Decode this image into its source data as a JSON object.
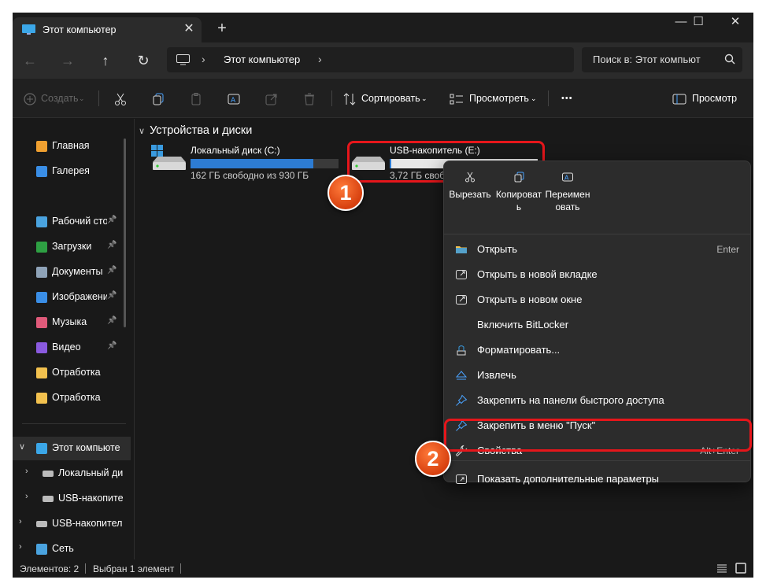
{
  "window": {
    "tab_title": "Этот компьютер",
    "tab_close": "✕",
    "new_tab": "+",
    "minimize": "—",
    "maximize": "☐",
    "close": "✕"
  },
  "nav": {
    "back": "←",
    "forward": "→",
    "up": "↑",
    "refresh": "↻",
    "breadcrumb": "Этот компьютер",
    "search_placeholder": "Поиск в: Этот компьют"
  },
  "toolbar": {
    "create": "Создать",
    "sort": "Сортировать",
    "view": "Просмотреть",
    "more": "•••",
    "preview": "Просмотр"
  },
  "sidebar": {
    "items": [
      {
        "label": "Главная",
        "icon": "home-icon",
        "color": "#f0a030",
        "pinned": false
      },
      {
        "label": "Галерея",
        "icon": "gallery-icon",
        "color": "#3a8ee6",
        "pinned": false
      },
      {
        "label": "Рабочий сто",
        "icon": "desktop-icon",
        "color": "#4aa3df",
        "pinned": true
      },
      {
        "label": "Загрузки",
        "icon": "download-icon",
        "color": "#2ea043",
        "pinned": true
      },
      {
        "label": "Документы",
        "icon": "documents-icon",
        "color": "#8fa3b8",
        "pinned": true
      },
      {
        "label": "Изображени",
        "icon": "pictures-icon",
        "color": "#3a8ee6",
        "pinned": true
      },
      {
        "label": "Музыка",
        "icon": "music-icon",
        "color": "#e05a7a",
        "pinned": true
      },
      {
        "label": "Видео",
        "icon": "video-icon",
        "color": "#8a5adf",
        "pinned": true
      },
      {
        "label": "Отработка",
        "icon": "folder-icon",
        "color": "#f2c14e",
        "pinned": false
      },
      {
        "label": "Отработка",
        "icon": "folder-icon",
        "color": "#f2c14e",
        "pinned": false
      }
    ],
    "tree": [
      {
        "label": "Этот компьюте",
        "icon": "computer-icon",
        "expanded": true
      },
      {
        "label": "Локальный ди",
        "icon": "drive-icon",
        "expanded": false
      },
      {
        "label": "USB-накопите",
        "icon": "usb-drive-icon",
        "expanded": false
      },
      {
        "label": "USB-накопител",
        "icon": "usb-drive-icon",
        "expanded": false
      },
      {
        "label": "Сеть",
        "icon": "network-icon",
        "expanded": false
      }
    ]
  },
  "content": {
    "group_title": "Устройства и диски",
    "drives": [
      {
        "name": "Локальный диск (C:)",
        "free": "162 ГБ свободно из 930 ГБ",
        "used_fraction": 0.83
      },
      {
        "name": "USB-накопитель (E:)",
        "free": "3,72 ГБ свобо",
        "used_fraction": 0.01
      }
    ]
  },
  "markers": {
    "one": "1",
    "two": "2"
  },
  "context_menu": {
    "top_actions": [
      {
        "label": "Вырезать",
        "icon": "cut-icon"
      },
      {
        "label": "Копировать",
        "icon": "copy-icon"
      },
      {
        "label": "Переименовать",
        "icon": "rename-icon"
      }
    ],
    "items": [
      {
        "label": "Открыть",
        "shortcut": "Enter",
        "icon": "open-folder-icon"
      },
      {
        "label": "Открыть в новой вкладке",
        "shortcut": "",
        "icon": "new-tab-icon"
      },
      {
        "label": "Открыть в новом окне",
        "shortcut": "",
        "icon": "new-window-icon"
      },
      {
        "label": "Включить BitLocker",
        "shortcut": "",
        "icon": ""
      },
      {
        "label": "Форматировать...",
        "shortcut": "",
        "icon": "format-icon"
      },
      {
        "label": "Извлечь",
        "shortcut": "",
        "icon": "eject-icon"
      },
      {
        "label": "Закрепить на панели быстрого доступа",
        "shortcut": "",
        "icon": "pin-icon"
      },
      {
        "label": "Закрепить в меню \"Пуск\"",
        "shortcut": "",
        "icon": "pin-start-icon"
      },
      {
        "label": "Свойства",
        "shortcut": "Alt+Enter",
        "icon": "wrench-icon"
      },
      {
        "label": "Показать дополнительные параметры",
        "shortcut": "",
        "icon": "more-options-icon"
      }
    ]
  },
  "status": {
    "items_count": "Элементов: 2",
    "selected": "Выбран 1 элемент"
  },
  "colors": {
    "accent": "#2d7cd3",
    "highlight": "#e6161b",
    "marker": "#e8541e"
  }
}
